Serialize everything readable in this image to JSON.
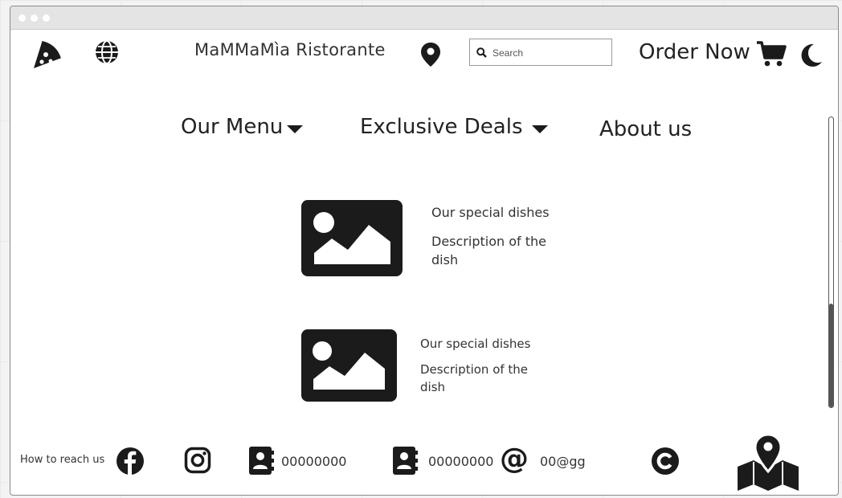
{
  "window": {
    "title": ""
  },
  "header": {
    "brand": "MaMMaMìa Ristorante",
    "search": {
      "placeholder": "Search",
      "value": ""
    },
    "order_now": "Order Now",
    "icons": {
      "pizza": "pizza-slice-icon",
      "globe": "globe-icon",
      "location": "location-pin-icon",
      "search": "search-icon",
      "cart": "shopping-cart-icon",
      "dark_mode": "moon-icon"
    }
  },
  "nav": {
    "items": [
      {
        "label": "Our Menu",
        "has_dropdown": true
      },
      {
        "label": "Exclusive Deals",
        "has_dropdown": true
      },
      {
        "label": "About us",
        "has_dropdown": false
      }
    ]
  },
  "dishes": [
    {
      "title": "Our special dishes",
      "description": "Description of the dish",
      "image_icon": "image-placeholder-icon"
    },
    {
      "title": "Our special dishes",
      "description": "Description of the dish",
      "image_icon": "image-placeholder-icon"
    }
  ],
  "footer": {
    "reach_label": "How to reach us",
    "phone_1": "00000000",
    "phone_2": "00000000",
    "email": "00@gg",
    "icons": [
      "facebook-icon",
      "instagram-icon",
      "contact-book-icon",
      "contact-book-icon",
      "at-sign-icon",
      "copyright-icon",
      "map-pin-icon"
    ]
  },
  "colors": {
    "ink": "#1b1b1b",
    "text": "#333333",
    "window_bg": "#ffffff",
    "titlebar": "#e4e4e4"
  }
}
